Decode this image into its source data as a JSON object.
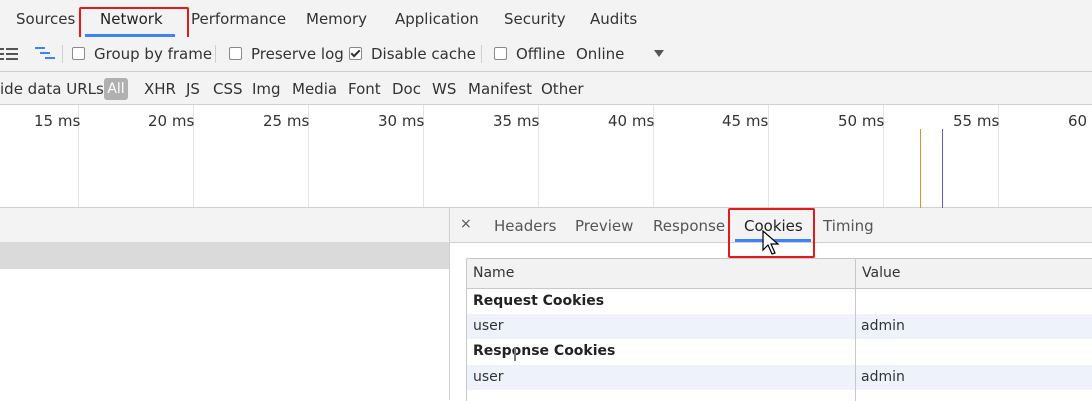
{
  "panel_tabs": [
    "Sources",
    "Network",
    "Performance",
    "Memory",
    "Application",
    "Security",
    "Audits"
  ],
  "toolbar": {
    "group_by_frame": "Group by frame",
    "preserve_log": "Preserve log",
    "disable_cache": "Disable cache",
    "offline": "Offline",
    "throttling": "Online",
    "disable_cache_checked": true,
    "icons": [
      "list-view-icon",
      "waterfall-icon",
      "dropdown-caret-icon"
    ]
  },
  "filters": {
    "hide_data_urls": "ide data URLs",
    "all": "All",
    "types": [
      "XHR",
      "JS",
      "CSS",
      "Img",
      "Media",
      "Font",
      "Doc",
      "WS",
      "Manifest",
      "Other"
    ]
  },
  "timeline": {
    "ticks": [
      "15 ms",
      "20 ms",
      "25 ms",
      "30 ms",
      "35 ms",
      "40 ms",
      "45 ms",
      "50 ms",
      "55 ms",
      "60 m"
    ],
    "marker_colors": [
      "#d9923a",
      "#5b5bd6"
    ]
  },
  "detail_tabs": {
    "close": "×",
    "tabs": [
      "Headers",
      "Preview",
      "Response",
      "Cookies",
      "Timing"
    ]
  },
  "cookies": {
    "headers": [
      "Name",
      "Value"
    ],
    "request_section": "Request Cookies",
    "request_rows": [
      {
        "name": "user",
        "value": "admin"
      }
    ],
    "response_section": "Response Cookies",
    "response_rows": [
      {
        "name": "user",
        "value": "admin"
      }
    ]
  },
  "colors": {
    "accent": "#3e82f7",
    "highlight_box": "#e11b1b",
    "toolbar_bg": "#f3f3f3"
  }
}
